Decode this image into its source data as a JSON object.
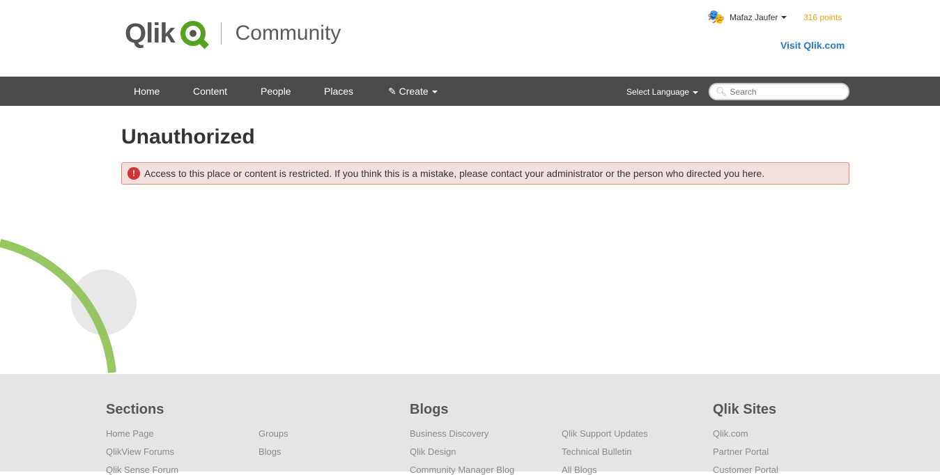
{
  "header": {
    "logo_text": "Qlik",
    "logo_sub": "Community",
    "user_name": "Mafaz Jaufer",
    "points": "316 points",
    "visit_link": "Visit Qlik.com"
  },
  "nav": {
    "items": [
      "Home",
      "Content",
      "People",
      "Places",
      "Create"
    ],
    "language": "Select Language",
    "search_placeholder": "Search"
  },
  "main": {
    "title": "Unauthorized",
    "alert": "Access to this place or content is restricted. If you think this is a mistake, please contact your administrator or the person who directed you here."
  },
  "footer": {
    "sections": {
      "title": "Sections",
      "col1": [
        "Home Page",
        "QlikView Forums",
        "Qlik Sense Forum"
      ],
      "col2": [
        "Groups",
        "Blogs"
      ]
    },
    "blogs": {
      "title": "Blogs",
      "col1": [
        "Business Discovery",
        "Qlik Design",
        "Community Manager Blog"
      ],
      "col2": [
        "Qlik Support Updates",
        "Technical Bulletin",
        "All Blogs"
      ]
    },
    "sites": {
      "title": "Qlik Sites",
      "col1": [
        "Qlik.com",
        "Partner Portal",
        "Customer Portal"
      ]
    }
  }
}
